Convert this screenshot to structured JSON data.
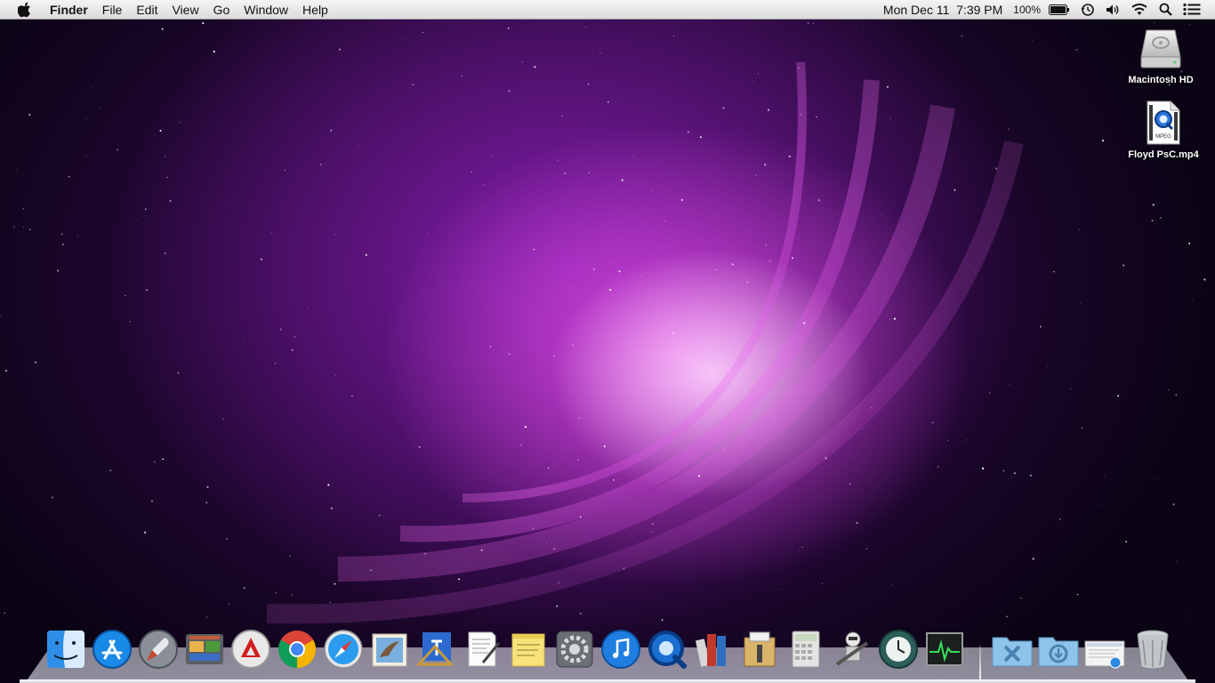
{
  "menubar": {
    "apple_icon": "apple-icon",
    "app_name": "Finder",
    "menus": [
      "File",
      "Edit",
      "View",
      "Go",
      "Window",
      "Help"
    ],
    "clock": "Mon Dec 11  7:39 PM",
    "battery_percent": "100%",
    "status_icons": [
      "battery-icon",
      "time-machine-icon",
      "volume-icon",
      "wifi-icon",
      "spotlight-icon",
      "notification-center-icon"
    ]
  },
  "desktop": {
    "items": [
      {
        "label": "Macintosh HD",
        "icon": "hard-drive-icon"
      },
      {
        "label": "Floyd PsC.mp4",
        "icon": "mpeg-file-icon",
        "badge": "MPEG"
      }
    ]
  },
  "dock": {
    "apps": [
      {
        "name": "Finder",
        "icon": "finder-icon"
      },
      {
        "name": "App Store",
        "icon": "app-store-icon"
      },
      {
        "name": "Launchpad",
        "icon": "launchpad-icon"
      },
      {
        "name": "Photo Slideshow",
        "icon": "photo-slideshow-icon"
      },
      {
        "name": "Adobe Acrobat",
        "icon": "acrobat-icon"
      },
      {
        "name": "Google Chrome",
        "icon": "chrome-icon"
      },
      {
        "name": "Safari",
        "icon": "safari-icon"
      },
      {
        "name": "Mail",
        "icon": "mail-icon"
      },
      {
        "name": "Xcode",
        "icon": "xcode-icon"
      },
      {
        "name": "TextEdit",
        "icon": "textedit-icon"
      },
      {
        "name": "Stickies",
        "icon": "stickies-icon"
      },
      {
        "name": "System Preferences",
        "icon": "system-preferences-icon"
      },
      {
        "name": "iTunes",
        "icon": "itunes-icon"
      },
      {
        "name": "QuickTime Player",
        "icon": "quicktime-icon"
      },
      {
        "name": "iBooks",
        "icon": "ibooks-icon"
      },
      {
        "name": "Archive Utility",
        "icon": "archive-utility-icon"
      },
      {
        "name": "Calculator",
        "icon": "calculator-icon"
      },
      {
        "name": "Automator",
        "icon": "automator-icon"
      },
      {
        "name": "Time Machine",
        "icon": "time-machine-app-icon"
      },
      {
        "name": "Activity Monitor",
        "icon": "activity-monitor-icon"
      }
    ],
    "stacks": [
      {
        "name": "Applications",
        "icon": "applications-folder-icon"
      },
      {
        "name": "Downloads",
        "icon": "downloads-folder-icon"
      },
      {
        "name": "Documents",
        "icon": "documents-stack-icon"
      },
      {
        "name": "Trash",
        "icon": "trash-icon"
      }
    ]
  },
  "colors": {
    "menubar_bg": "#e8e8e8",
    "wallpaper_base": "#0a0414",
    "wallpaper_glow": "#e040e8",
    "wallpaper_core": "#ffd0ff"
  }
}
